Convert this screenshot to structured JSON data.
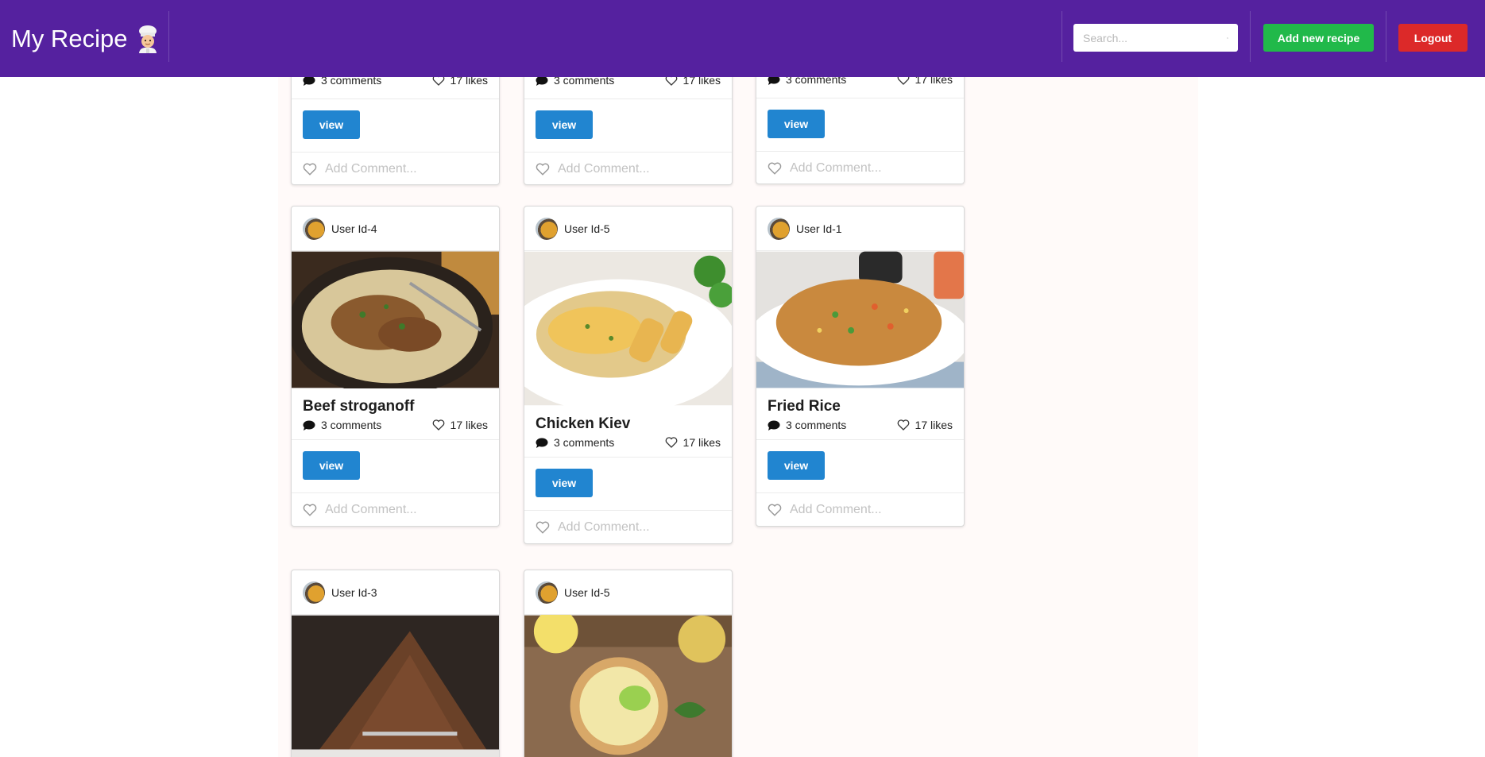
{
  "header": {
    "brand": "My Recipe",
    "brand_icon": "chef-emoji-icon",
    "search": {
      "placeholder": "Search...",
      "value": ""
    },
    "add_label": "Add new recipe",
    "logout_label": "Logout"
  },
  "colors": {
    "navbar": "#55219f",
    "add": "#21b94a",
    "logout": "#dc2929",
    "view": "#2185d0"
  },
  "cards_top": [
    {
      "comments": "3 comments",
      "likes": "17 likes",
      "view_label": "view",
      "comment_placeholder": "Add Comment..."
    },
    {
      "comments": "3 comments",
      "likes": "17 likes",
      "view_label": "view",
      "comment_placeholder": "Add Comment..."
    },
    {
      "comments": "3 comments",
      "likes": "17 likes",
      "view_label": "view",
      "comment_placeholder": "Add Comment..."
    }
  ],
  "cards_mid": [
    {
      "user": "User Id-4",
      "title": "Beef stroganoff",
      "comments": "3 comments",
      "likes": "17 likes",
      "view_label": "view",
      "comment_placeholder": "Add Comment..."
    },
    {
      "user": "User Id-5",
      "title": "Chicken Kiev",
      "comments": "3 comments",
      "likes": "17 likes",
      "view_label": "view",
      "comment_placeholder": "Add Comment..."
    },
    {
      "user": "User Id-1",
      "title": "Fried Rice",
      "comments": "3 comments",
      "likes": "17 likes",
      "view_label": "view",
      "comment_placeholder": "Add Comment..."
    }
  ],
  "cards_bottom": [
    {
      "user": "User Id-3"
    },
    {
      "user": "User Id-5"
    }
  ]
}
